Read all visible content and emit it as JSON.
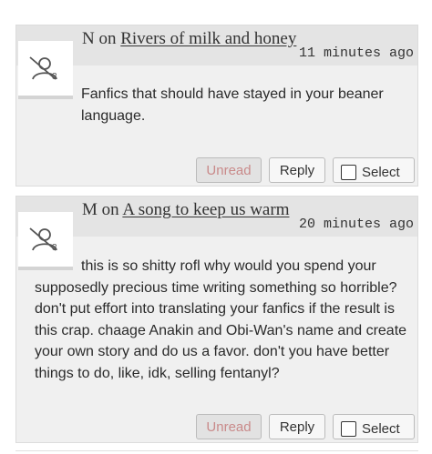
{
  "comments": [
    {
      "author": "N",
      "on_word": "on",
      "story": "Rivers of milk and honey",
      "time": "11 minutes ago",
      "body": "Fanfics that should have stayed in your beaner language.",
      "avatar_icon": "no-avatar-icon",
      "unread_label": "Unread",
      "reply_label": "Reply",
      "select_label": "Select",
      "selected": false
    },
    {
      "author": "M",
      "on_word": "on",
      "story": "A song to keep us warm",
      "time": "20 minutes ago",
      "body": "this is so shitty rofl why would you spend your supposedly precious time writing something so horrible? don't put effort into translating your fanfics if the result is this crap. chaage Anakin and Obi-Wan's name and create your own story and do us a favor. don't you have better things to do, like, idk, selling fentanyl?",
      "avatar_icon": "no-avatar-icon",
      "unread_label": "Unread",
      "reply_label": "Reply",
      "select_label": "Select",
      "selected": false
    }
  ],
  "colors": {
    "card_bg": "#f0f0f0",
    "header_bg": "#e4e4e4",
    "unread_text": "#c98a8a"
  }
}
